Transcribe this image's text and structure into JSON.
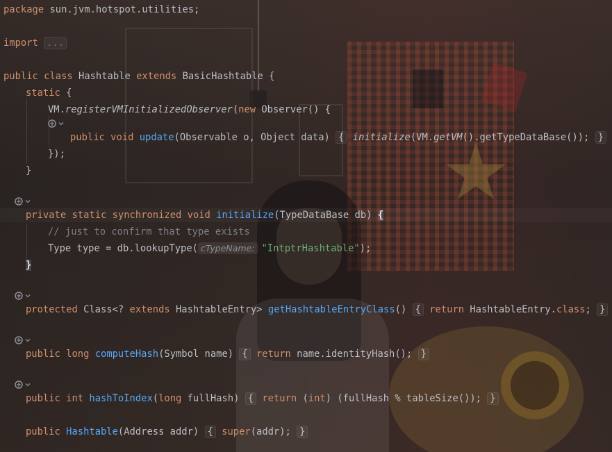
{
  "code": {
    "l1": {
      "kw": "package",
      "rest": " sun.jvm.hotspot.utilities;"
    },
    "l2": {
      "kw": "import",
      "fold": "..."
    },
    "l3": {
      "kw1": "public",
      "kw2": "class",
      "name": "Hashtable",
      "kw3": "extends",
      "base": "BasicHashtable",
      "brace": "{"
    },
    "l4": {
      "kw": "static",
      "brace": "{"
    },
    "l5": {
      "vm": "VM.",
      "method": "registerVMInitializedObserver",
      "open": "(",
      "kw": "new",
      "rest": " Observer() {"
    },
    "l6": {
      "kw1": "public",
      "kw2": "void",
      "fn": "update",
      "params": "(Observable o, Object data)",
      "ob": "{",
      "call": "initialize",
      "args1": "(VM.",
      "getvm": "getVM",
      "args2": "().getTypeDataBase());",
      "cb": "}"
    },
    "l7": {
      "text": "});"
    },
    "l8": {
      "text": "}"
    },
    "l9": {
      "kw1": "private",
      "kw2": "static",
      "kw3": "synchronized",
      "kw4": "void",
      "fn": "initialize",
      "params": "(TypeDataBase db) ",
      "brace": "{"
    },
    "l10": {
      "comment": "// just to confirm that type exists"
    },
    "l11": {
      "pre": "Type type = db.lookupType(",
      "hint": "cTypeName:",
      "str": "\"IntptrHashtable\"",
      "post": ");"
    },
    "l12": {
      "text": "}"
    },
    "l13": {
      "kw1": "protected",
      "cls": " Class<? ",
      "kw2": "extends",
      "mid": " HashtableEntry> ",
      "fn": "getHashtableEntryClass",
      "par": "()",
      "ob": "{",
      "kwret": "return",
      "body": " HashtableEntry.",
      "kwcls": "class",
      "semi": ";",
      "cb": "}"
    },
    "l14": {
      "kw1": "public",
      "kw2": "long",
      "fn": "computeHash",
      "params": "(Symbol name)",
      "ob": "{",
      "kwret": "return",
      "body": " name.identityHash();",
      "cb": "}"
    },
    "l15": {
      "kw1": "public",
      "kw2": "int",
      "fn": "hashToIndex",
      "params": "(",
      "kw3": "long",
      "params2": " fullHash)",
      "ob": "{",
      "kwret": "return",
      "cast1": " (",
      "kwint": "int",
      "body": ") (fullHash % tableSize());",
      "cb": "}"
    },
    "l16": {
      "kw1": "public",
      "fn": "Hashtable",
      "params": "(Address addr)",
      "ob": "{",
      "kwsuper": "super",
      "body": "(addr);",
      "cb": "}"
    }
  },
  "gutter": {
    "marker_icon": "override-icon",
    "fold_icon": "chevron-down-icon"
  },
  "colors": {
    "keyword": "#cf8e6d",
    "function": "#56a8f5",
    "string": "#6aab73",
    "comment": "#7a7e85",
    "text": "#bcbec4"
  }
}
